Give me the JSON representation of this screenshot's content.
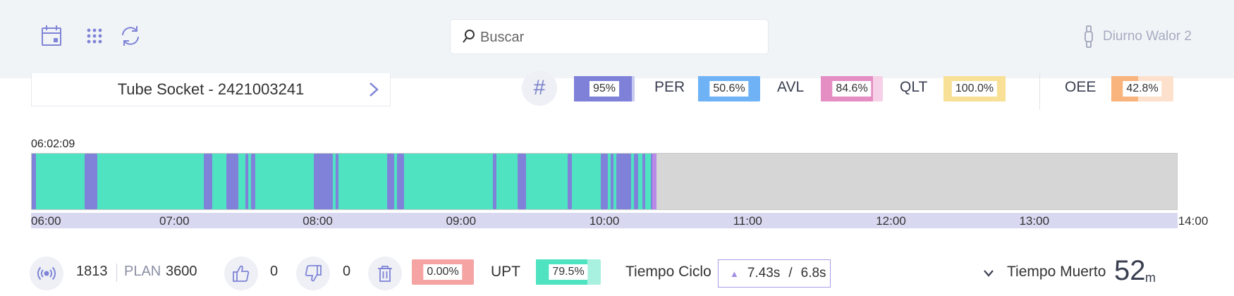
{
  "header": {
    "icons": [
      "calendar-icon",
      "grid-icon",
      "refresh-icon"
    ],
    "search": {
      "placeholder": "Buscar",
      "value": ""
    },
    "user_name": "Diurno Walor 2"
  },
  "product": {
    "name": "Tube Socket - 2421003241"
  },
  "kpis": {
    "first": {
      "value": "95%",
      "fraction": 0.95,
      "color": "#7f81d8"
    },
    "per": {
      "label": "PER",
      "value": "50.6%",
      "fraction": 0.506,
      "color": "#6fb3f6"
    },
    "avl": {
      "label": "AVL",
      "value": "84.6%",
      "fraction": 0.846,
      "color": "#e48ec3",
      "bg": "#f6d0e6"
    },
    "qlt": {
      "label": "QLT",
      "value": "100.0%",
      "fraction": 1.0,
      "color": "#f8e096"
    },
    "oee": {
      "label": "OEE",
      "value": "42.8%",
      "fraction": 0.428,
      "color": "#f9b37c",
      "bg": "#fde1cc"
    }
  },
  "timeline": {
    "current_time": "06:02:09",
    "ticks": [
      "06:00",
      "07:00",
      "08:00",
      "09:00",
      "10:00",
      "11:00",
      "12:00",
      "13:00",
      "14:00"
    ],
    "colors": {
      "run": "#4fe3c2",
      "stop": "#8082da",
      "current": "#b98ae8"
    },
    "stops_hours": [
      [
        0.0,
        0.03
      ],
      [
        0.37,
        0.46
      ],
      [
        1.2,
        1.26
      ],
      [
        1.36,
        1.44
      ],
      [
        1.49,
        1.51
      ],
      [
        1.53,
        1.56
      ],
      [
        1.97,
        2.1
      ],
      [
        2.12,
        2.14
      ],
      [
        2.48,
        2.53
      ],
      [
        2.55,
        2.6
      ],
      [
        3.22,
        3.24
      ],
      [
        3.39,
        3.45
      ],
      [
        3.74,
        3.77
      ],
      [
        3.97,
        4.02
      ],
      [
        4.04,
        4.06
      ],
      [
        4.08,
        4.18
      ],
      [
        4.2,
        4.23
      ],
      [
        4.26,
        4.28
      ],
      [
        4.32,
        4.33
      ]
    ],
    "current_marker_hours": [
      4.33,
      4.36
    ],
    "end_hours": 4.36,
    "span_hours": 8
  },
  "stats": {
    "count": "1813",
    "plan_label": "PLAN",
    "plan_value": "3600",
    "good": "0",
    "bad": "0",
    "scrap_value": "0.00%",
    "scrap_color": "#f5a3a3",
    "upt_label": "UPT",
    "upt_value": "79.5%",
    "upt_fraction": 0.795,
    "upt_color": "#4fe3c2",
    "upt_bg": "#a8f0e0",
    "cycle_label": "Tiempo Ciclo",
    "cycle_actual": "7.43s",
    "cycle_sep": "/",
    "cycle_target": "6.8s",
    "dead_label": "Tiempo Muerto",
    "dead_value": "52",
    "dead_unit": "m"
  }
}
